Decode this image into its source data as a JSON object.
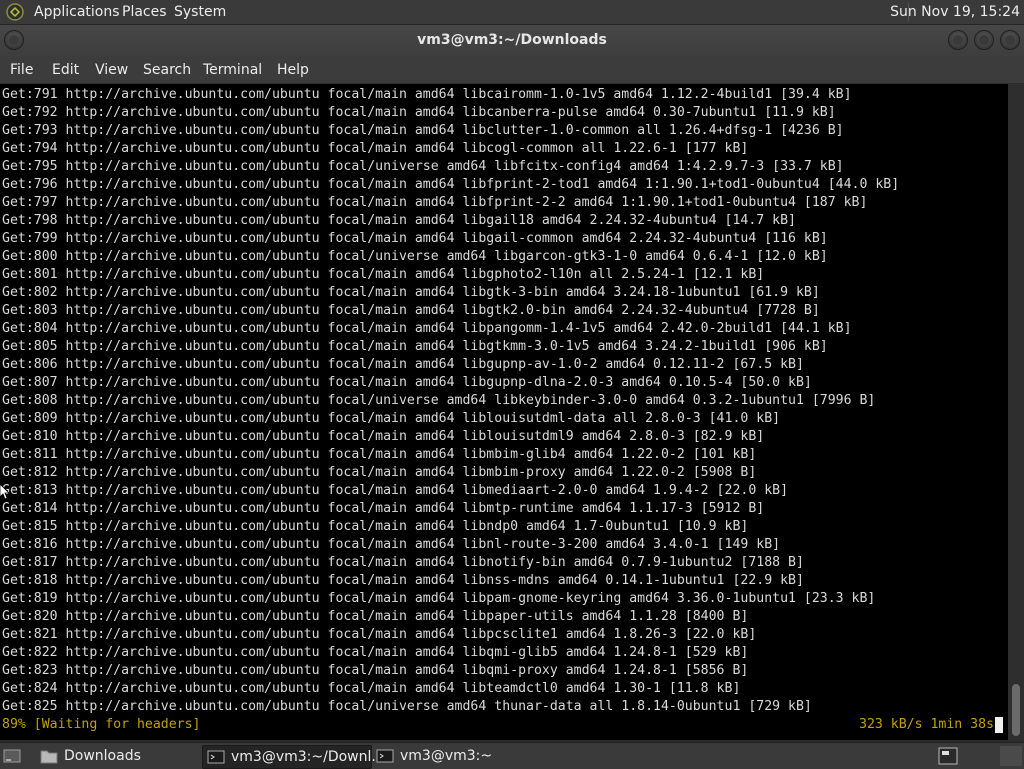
{
  "top_panel": {
    "logo_icon": "distro-logo-icon",
    "menus": [
      "Applications",
      "Places",
      "System"
    ],
    "clock": "Sun Nov 19, 15:24"
  },
  "window": {
    "title": "vm3@vm3:~/Downloads",
    "menus": [
      "File",
      "Edit",
      "View",
      "Search",
      "Terminal",
      "Help"
    ]
  },
  "terminal": {
    "lines": [
      "Get:791 http://archive.ubuntu.com/ubuntu focal/main amd64 libcairomm-1.0-1v5 amd64 1.12.2-4build1 [39.4 kB]",
      "Get:792 http://archive.ubuntu.com/ubuntu focal/main amd64 libcanberra-pulse amd64 0.30-7ubuntu1 [11.9 kB]",
      "Get:793 http://archive.ubuntu.com/ubuntu focal/main amd64 libclutter-1.0-common all 1.26.4+dfsg-1 [4236 B]",
      "Get:794 http://archive.ubuntu.com/ubuntu focal/main amd64 libcogl-common all 1.22.6-1 [177 kB]",
      "Get:795 http://archive.ubuntu.com/ubuntu focal/universe amd64 libfcitx-config4 amd64 1:4.2.9.7-3 [33.7 kB]",
      "Get:796 http://archive.ubuntu.com/ubuntu focal/main amd64 libfprint-2-tod1 amd64 1:1.90.1+tod1-0ubuntu4 [44.0 kB]",
      "Get:797 http://archive.ubuntu.com/ubuntu focal/main amd64 libfprint-2-2 amd64 1:1.90.1+tod1-0ubuntu4 [187 kB]",
      "Get:798 http://archive.ubuntu.com/ubuntu focal/main amd64 libgail18 amd64 2.24.32-4ubuntu4 [14.7 kB]",
      "Get:799 http://archive.ubuntu.com/ubuntu focal/main amd64 libgail-common amd64 2.24.32-4ubuntu4 [116 kB]",
      "Get:800 http://archive.ubuntu.com/ubuntu focal/universe amd64 libgarcon-gtk3-1-0 amd64 0.6.4-1 [12.0 kB]",
      "Get:801 http://archive.ubuntu.com/ubuntu focal/main amd64 libgphoto2-l10n all 2.5.24-1 [12.1 kB]",
      "Get:802 http://archive.ubuntu.com/ubuntu focal/main amd64 libgtk-3-bin amd64 3.24.18-1ubuntu1 [61.9 kB]",
      "Get:803 http://archive.ubuntu.com/ubuntu focal/main amd64 libgtk2.0-bin amd64 2.24.32-4ubuntu4 [7728 B]",
      "Get:804 http://archive.ubuntu.com/ubuntu focal/main amd64 libpangomm-1.4-1v5 amd64 2.42.0-2build1 [44.1 kB]",
      "Get:805 http://archive.ubuntu.com/ubuntu focal/main amd64 libgtkmm-3.0-1v5 amd64 3.24.2-1build1 [906 kB]",
      "Get:806 http://archive.ubuntu.com/ubuntu focal/main amd64 libgupnp-av-1.0-2 amd64 0.12.11-2 [67.5 kB]",
      "Get:807 http://archive.ubuntu.com/ubuntu focal/main amd64 libgupnp-dlna-2.0-3 amd64 0.10.5-4 [50.0 kB]",
      "Get:808 http://archive.ubuntu.com/ubuntu focal/universe amd64 libkeybinder-3.0-0 amd64 0.3.2-1ubuntu1 [7996 B]",
      "Get:809 http://archive.ubuntu.com/ubuntu focal/main amd64 liblouisutdml-data all 2.8.0-3 [41.0 kB]",
      "Get:810 http://archive.ubuntu.com/ubuntu focal/main amd64 liblouisutdml9 amd64 2.8.0-3 [82.9 kB]",
      "Get:811 http://archive.ubuntu.com/ubuntu focal/main amd64 libmbim-glib4 amd64 1.22.0-2 [101 kB]",
      "Get:812 http://archive.ubuntu.com/ubuntu focal/main amd64 libmbim-proxy amd64 1.22.0-2 [5908 B]",
      "Get:813 http://archive.ubuntu.com/ubuntu focal/main amd64 libmediaart-2.0-0 amd64 1.9.4-2 [22.0 kB]",
      "Get:814 http://archive.ubuntu.com/ubuntu focal/main amd64 libmtp-runtime amd64 1.1.17-3 [5912 B]",
      "Get:815 http://archive.ubuntu.com/ubuntu focal/main amd64 libndp0 amd64 1.7-0ubuntu1 [10.9 kB]",
      "Get:816 http://archive.ubuntu.com/ubuntu focal/main amd64 libnl-route-3-200 amd64 3.4.0-1 [149 kB]",
      "Get:817 http://archive.ubuntu.com/ubuntu focal/main amd64 libnotify-bin amd64 0.7.9-1ubuntu2 [7188 B]",
      "Get:818 http://archive.ubuntu.com/ubuntu focal/main amd64 libnss-mdns amd64 0.14.1-1ubuntu1 [22.9 kB]",
      "Get:819 http://archive.ubuntu.com/ubuntu focal/main amd64 libpam-gnome-keyring amd64 3.36.0-1ubuntu1 [23.3 kB]",
      "Get:820 http://archive.ubuntu.com/ubuntu focal/main amd64 libpaper-utils amd64 1.1.28 [8400 B]",
      "Get:821 http://archive.ubuntu.com/ubuntu focal/main amd64 libpcsclite1 amd64 1.8.26-3 [22.0 kB]",
      "Get:822 http://archive.ubuntu.com/ubuntu focal/main amd64 libqmi-glib5 amd64 1.24.8-1 [529 kB]",
      "Get:823 http://archive.ubuntu.com/ubuntu focal/main amd64 libqmi-proxy amd64 1.24.8-1 [5856 B]",
      "Get:824 http://archive.ubuntu.com/ubuntu focal/main amd64 libteamdctl0 amd64 1.30-1 [11.8 kB]",
      "Get:825 http://archive.ubuntu.com/ubuntu focal/universe amd64 thunar-data all 1.8.14-0ubuntu1 [729 kB]"
    ],
    "status_left": "89% [Waiting for headers]",
    "status_right": "323 kB/s 1min 38s",
    "status_color": "#c4a000",
    "scroll_position": 0.95
  },
  "taskbar": {
    "tasks": [
      {
        "label": "Downloads",
        "icon": "folder-icon",
        "active": false
      },
      {
        "label": "vm3@vm3:~/Downl...",
        "icon": "terminal-icon",
        "active": true
      },
      {
        "label": "vm3@vm3:~",
        "icon": "terminal-icon",
        "active": false
      }
    ],
    "show_desktop_icon": "show-desktop-icon",
    "tray_icon": "workspace-switcher-icon"
  }
}
